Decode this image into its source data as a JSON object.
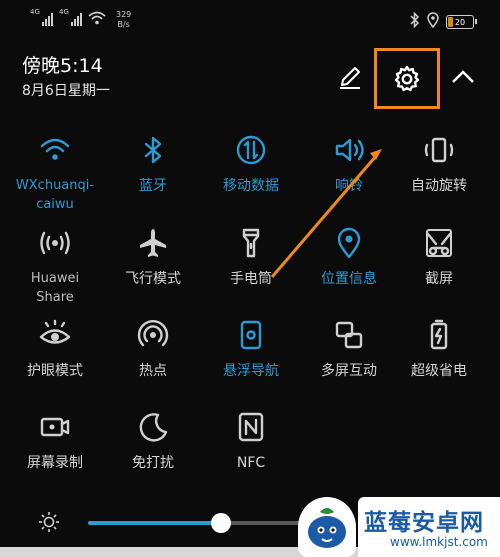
{
  "status_bar": {
    "signal1": "4G",
    "signal2": "4G",
    "net_speed_value": "329",
    "net_speed_unit": "B/s",
    "battery": "20",
    "battery_level": 0.2,
    "icons": [
      "bluetooth-icon",
      "location-icon",
      "battery-icon"
    ]
  },
  "header": {
    "time": "傍晚5:14",
    "date": "8月6日星期一"
  },
  "colors": {
    "accent": "#2b9bd4",
    "highlight": "#ee8a1b",
    "background": "#0b0b0b",
    "text": "#d4d4d4"
  },
  "tiles": [
    {
      "label": "WXchuanqi-caiwu",
      "icon": "wifi-icon",
      "active": true
    },
    {
      "label": "蓝牙",
      "icon": "bluetooth-icon",
      "active": true
    },
    {
      "label": "移动数据",
      "icon": "mobile-data-icon",
      "active": true
    },
    {
      "label": "响铃",
      "icon": "volume-icon",
      "active": true
    },
    {
      "label": "自动旋转",
      "icon": "rotate-icon",
      "active": false
    },
    {
      "label": "Huawei Share",
      "icon": "huawei-share-icon",
      "active": false
    },
    {
      "label": "飞行模式",
      "icon": "airplane-icon",
      "active": false
    },
    {
      "label": "手电筒",
      "icon": "flashlight-icon",
      "active": false
    },
    {
      "label": "位置信息",
      "icon": "location-icon",
      "active": true
    },
    {
      "label": "截屏",
      "icon": "screenshot-icon",
      "active": false
    },
    {
      "label": "护眼模式",
      "icon": "eye-icon",
      "active": false
    },
    {
      "label": "热点",
      "icon": "hotspot-icon",
      "active": false
    },
    {
      "label": "悬浮导航",
      "icon": "floating-nav-icon",
      "active": true
    },
    {
      "label": "多屏互动",
      "icon": "multi-screen-icon",
      "active": false
    },
    {
      "label": "超级省电",
      "icon": "power-saving-icon",
      "active": false
    },
    {
      "label": "屏幕录制",
      "icon": "screen-record-icon",
      "active": false
    },
    {
      "label": "免打扰",
      "icon": "do-not-disturb-icon",
      "active": false
    },
    {
      "label": "NFC",
      "icon": "nfc-icon",
      "active": false
    }
  ],
  "brightness": {
    "level": 0.58,
    "icon": "sun-icon"
  },
  "watermark": {
    "brand": "蓝莓安卓网",
    "url": "www.lmkjst.com"
  }
}
